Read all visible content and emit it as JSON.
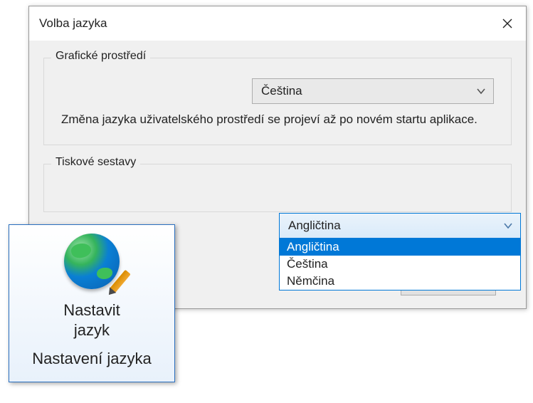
{
  "dialog": {
    "title": "Volba jazyka",
    "group_ui": {
      "legend": "Grafické prostředí",
      "selected": "Čeština",
      "hint": "Změna jazyka uživatelského prostředí se projeví až po novém startu aplikace."
    },
    "group_reports": {
      "legend": "Tiskové sestavy",
      "selected": "Angličtina",
      "options": [
        "Angličtina",
        "Čeština",
        "Němčina"
      ]
    }
  },
  "ribbon": {
    "label_line1": "Nastavit",
    "label_line2": "jazyk",
    "sublabel": "Nastavení jazyka"
  }
}
